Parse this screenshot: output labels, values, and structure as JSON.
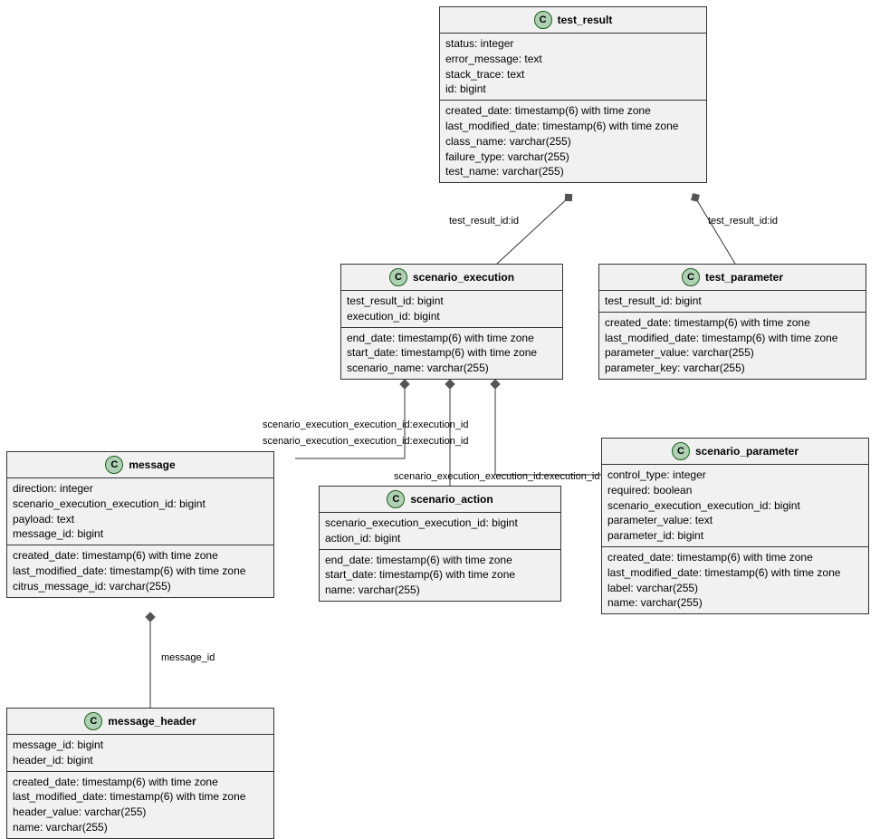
{
  "entities": {
    "test_result": {
      "name": "test_result",
      "sections": [
        [
          "status: integer",
          "error_message: text",
          "stack_trace: text",
          "id: bigint"
        ],
        [
          "created_date: timestamp(6) with time zone",
          "last_modified_date: timestamp(6) with time zone",
          "class_name: varchar(255)",
          "failure_type: varchar(255)",
          "test_name: varchar(255)"
        ]
      ]
    },
    "scenario_execution": {
      "name": "scenario_execution",
      "sections": [
        [
          "test_result_id: bigint",
          "execution_id: bigint"
        ],
        [
          "end_date: timestamp(6) with time zone",
          "start_date: timestamp(6) with time zone",
          "scenario_name: varchar(255)"
        ]
      ]
    },
    "test_parameter": {
      "name": "test_parameter",
      "sections": [
        [
          "test_result_id: bigint"
        ],
        [
          "created_date: timestamp(6) with time zone",
          "last_modified_date: timestamp(6) with time zone",
          "parameter_value: varchar(255)",
          "parameter_key: varchar(255)"
        ]
      ]
    },
    "message": {
      "name": "message",
      "sections": [
        [
          "direction: integer",
          "scenario_execution_execution_id: bigint",
          "payload: text",
          "message_id: bigint"
        ],
        [
          "created_date: timestamp(6) with time zone",
          "last_modified_date: timestamp(6) with time zone",
          "citrus_message_id: varchar(255)"
        ]
      ]
    },
    "scenario_action": {
      "name": "scenario_action",
      "sections": [
        [
          "scenario_execution_execution_id: bigint",
          "action_id: bigint"
        ],
        [
          "end_date: timestamp(6) with time zone",
          "start_date: timestamp(6) with time zone",
          "name: varchar(255)"
        ]
      ]
    },
    "scenario_parameter": {
      "name": "scenario_parameter",
      "sections": [
        [
          "control_type: integer",
          "required: boolean",
          "scenario_execution_execution_id: bigint",
          "parameter_value: text",
          "parameter_id: bigint"
        ],
        [
          "created_date: timestamp(6) with time zone",
          "last_modified_date: timestamp(6) with time zone",
          "label: varchar(255)",
          "name: varchar(255)"
        ]
      ]
    },
    "message_header": {
      "name": "message_header",
      "sections": [
        [
          "message_id: bigint",
          "header_id: bigint"
        ],
        [
          "created_date: timestamp(6) with time zone",
          "last_modified_date: timestamp(6) with time zone",
          "header_value: varchar(255)",
          "name: varchar(255)"
        ]
      ]
    }
  },
  "edge_labels": {
    "tr_se": "test_result_id:id",
    "tr_tp": "test_result_id:id",
    "se_msg": "scenario_execution_execution_id:execution_id",
    "se_sa": "scenario_execution_execution_id:execution_id",
    "se_sp": "scenario_execution_execution_id:execution_id",
    "msg_mh": "message_id"
  }
}
